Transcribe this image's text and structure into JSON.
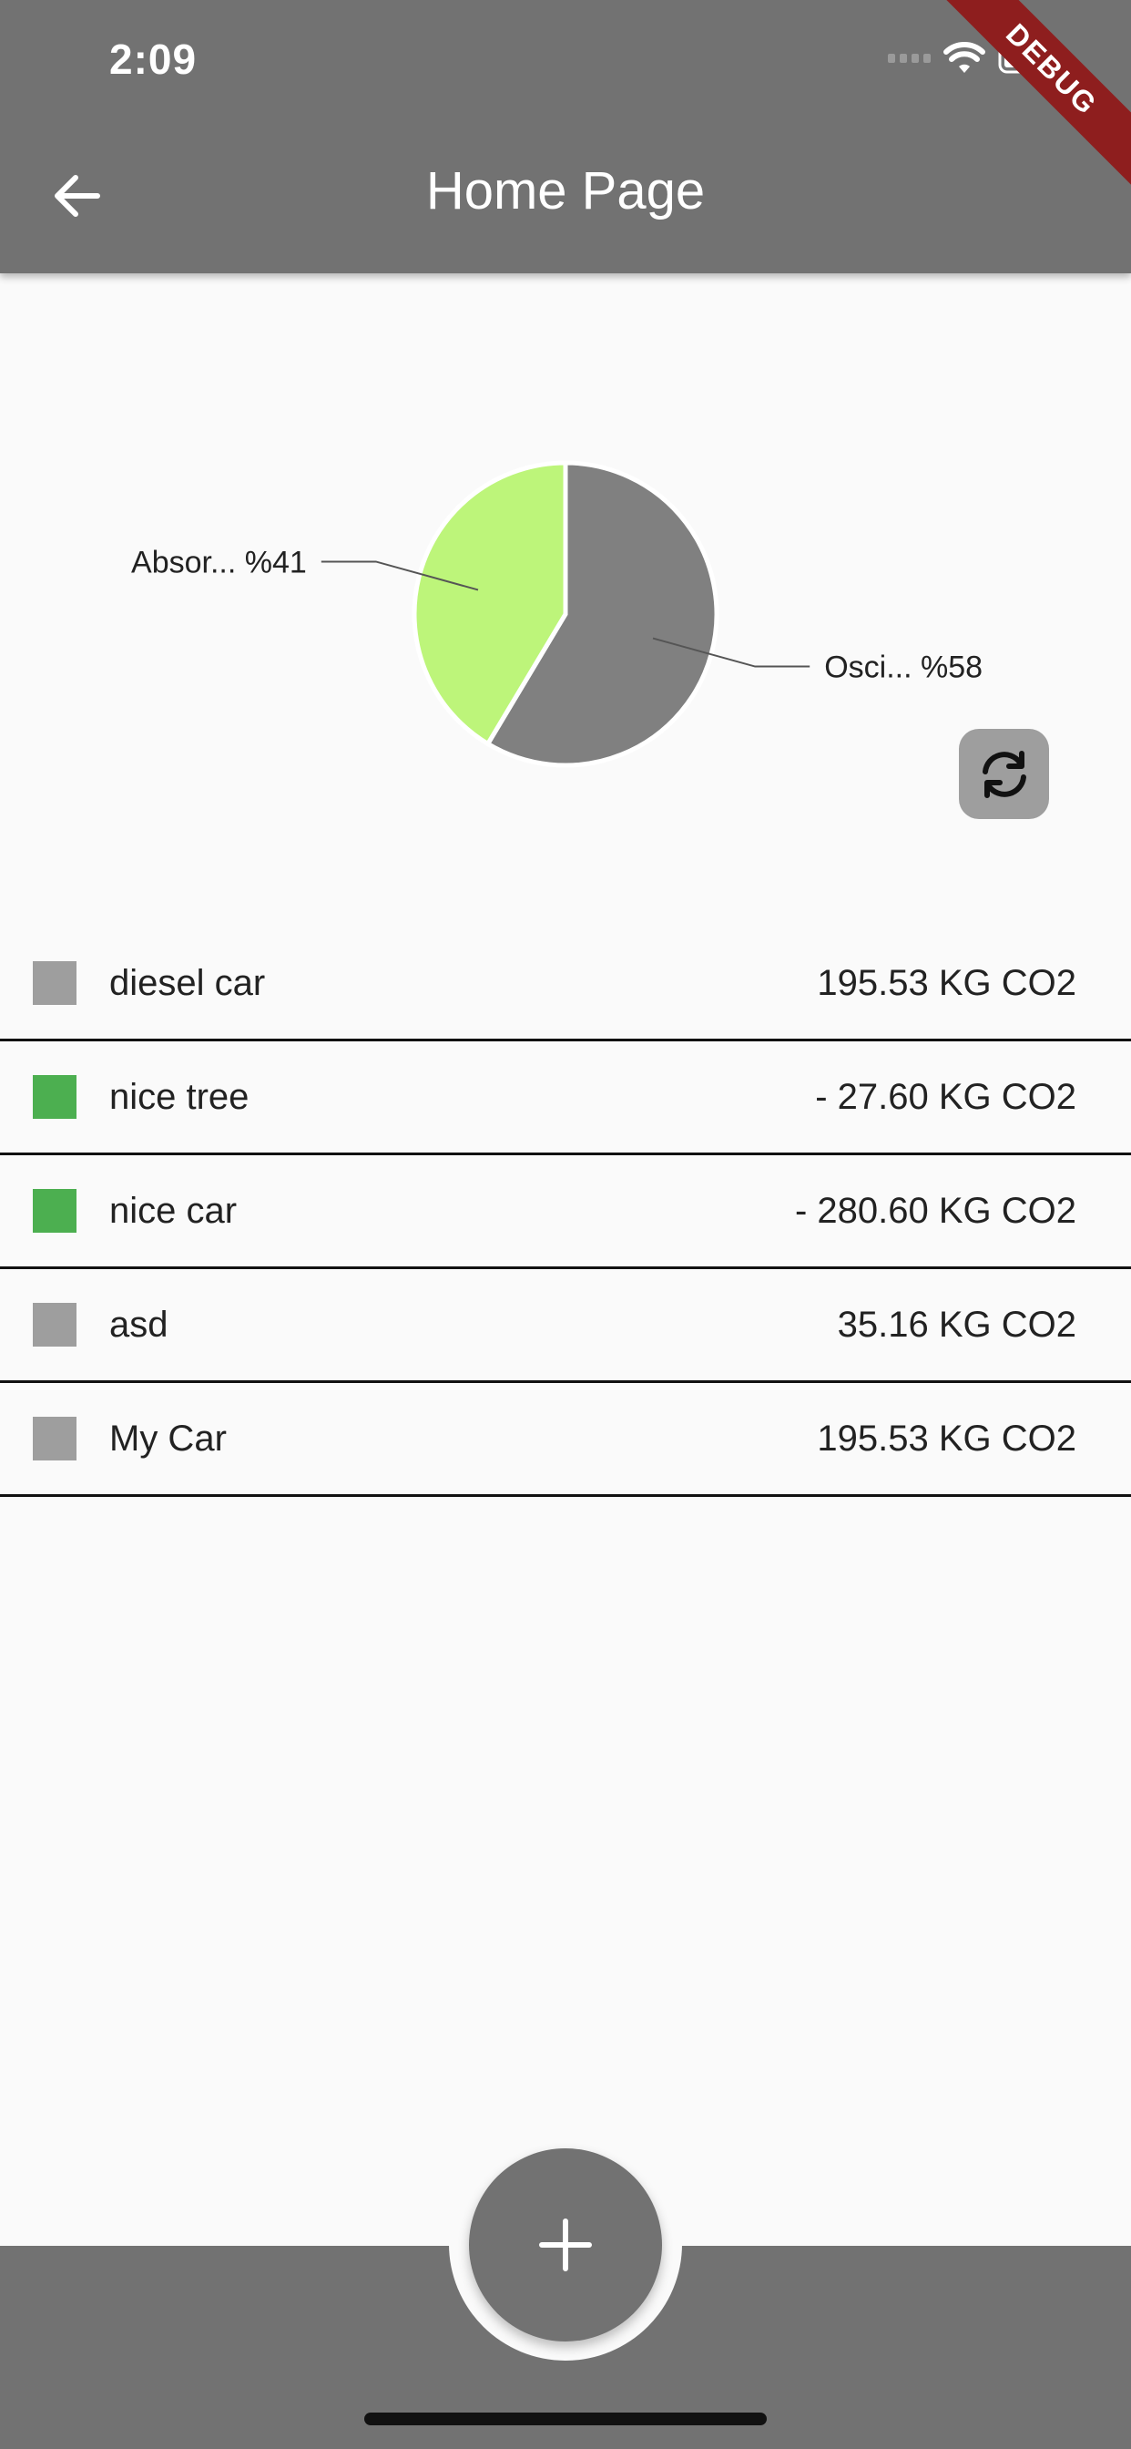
{
  "status_bar": {
    "time": "2:09"
  },
  "app_bar": {
    "title": "Home Page",
    "back_icon": "arrow-left-icon"
  },
  "debug_banner": "DEBUG",
  "chart_data": {
    "type": "pie",
    "slices": [
      {
        "label": "Osci... %58",
        "value": 58,
        "color": "#808080"
      },
      {
        "label": "Absor... %41",
        "value": 41,
        "color": "#bdf57a"
      }
    ]
  },
  "refresh_button": {
    "icon": "refresh-icon"
  },
  "items": [
    {
      "name": "diesel car",
      "value": "195.53 KG CO2",
      "color": "#9e9e9e"
    },
    {
      "name": "nice tree",
      "value": "- 27.60 KG CO2",
      "color": "#4caf50"
    },
    {
      "name": "nice car",
      "value": "- 280.60 KG CO2",
      "color": "#4caf50"
    },
    {
      "name": "asd",
      "value": "35.16 KG CO2",
      "color": "#9e9e9e"
    },
    {
      "name": "My Car",
      "value": "195.53 KG CO2",
      "color": "#9e9e9e"
    }
  ],
  "fab": {
    "icon": "plus-icon"
  }
}
